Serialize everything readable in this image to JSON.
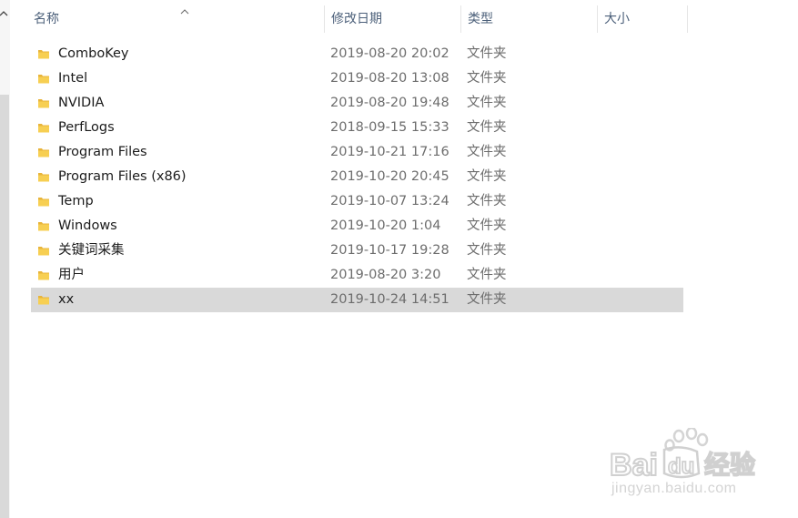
{
  "columns": {
    "name": "名称",
    "date_modified": "修改日期",
    "type": "类型",
    "size": "大小"
  },
  "files": [
    {
      "name": "ComboKey",
      "date": "2019-08-20 20:02",
      "type": "文件夹",
      "icon": "folder-icon"
    },
    {
      "name": "Intel",
      "date": "2019-08-20 13:08",
      "type": "文件夹",
      "icon": "folder-icon"
    },
    {
      "name": "NVIDIA",
      "date": "2019-08-20 19:48",
      "type": "文件夹",
      "icon": "folder-icon"
    },
    {
      "name": "PerfLogs",
      "date": "2018-09-15 15:33",
      "type": "文件夹",
      "icon": "folder-icon"
    },
    {
      "name": "Program Files",
      "date": "2019-10-21 17:16",
      "type": "文件夹",
      "icon": "folder-icon"
    },
    {
      "name": "Program Files (x86)",
      "date": "2019-10-20 20:45",
      "type": "文件夹",
      "icon": "folder-icon"
    },
    {
      "name": "Temp",
      "date": "2019-10-07 13:24",
      "type": "文件夹",
      "icon": "folder-icon"
    },
    {
      "name": "Windows",
      "date": "2019-10-20 1:04",
      "type": "文件夹",
      "icon": "folder-icon"
    },
    {
      "name": "关键词采集",
      "date": "2019-10-17 19:28",
      "type": "文件夹",
      "icon": "folder-icon"
    },
    {
      "name": "用户",
      "date": "2019-08-20 3:20",
      "type": "文件夹",
      "icon": "folder-icon"
    },
    {
      "name": "xx",
      "date": "2019-10-24 14:51",
      "type": "文件夹",
      "icon": "folder-icon",
      "selected": true
    }
  ],
  "watermark": {
    "brand": "Bai du 经验",
    "url": "jingyan.baidu.com"
  },
  "colors": {
    "folder": "#f0c040",
    "selected_row": "#d9d9d9",
    "header_text": "#4c607a",
    "secondary_text": "#6d6d6d"
  }
}
